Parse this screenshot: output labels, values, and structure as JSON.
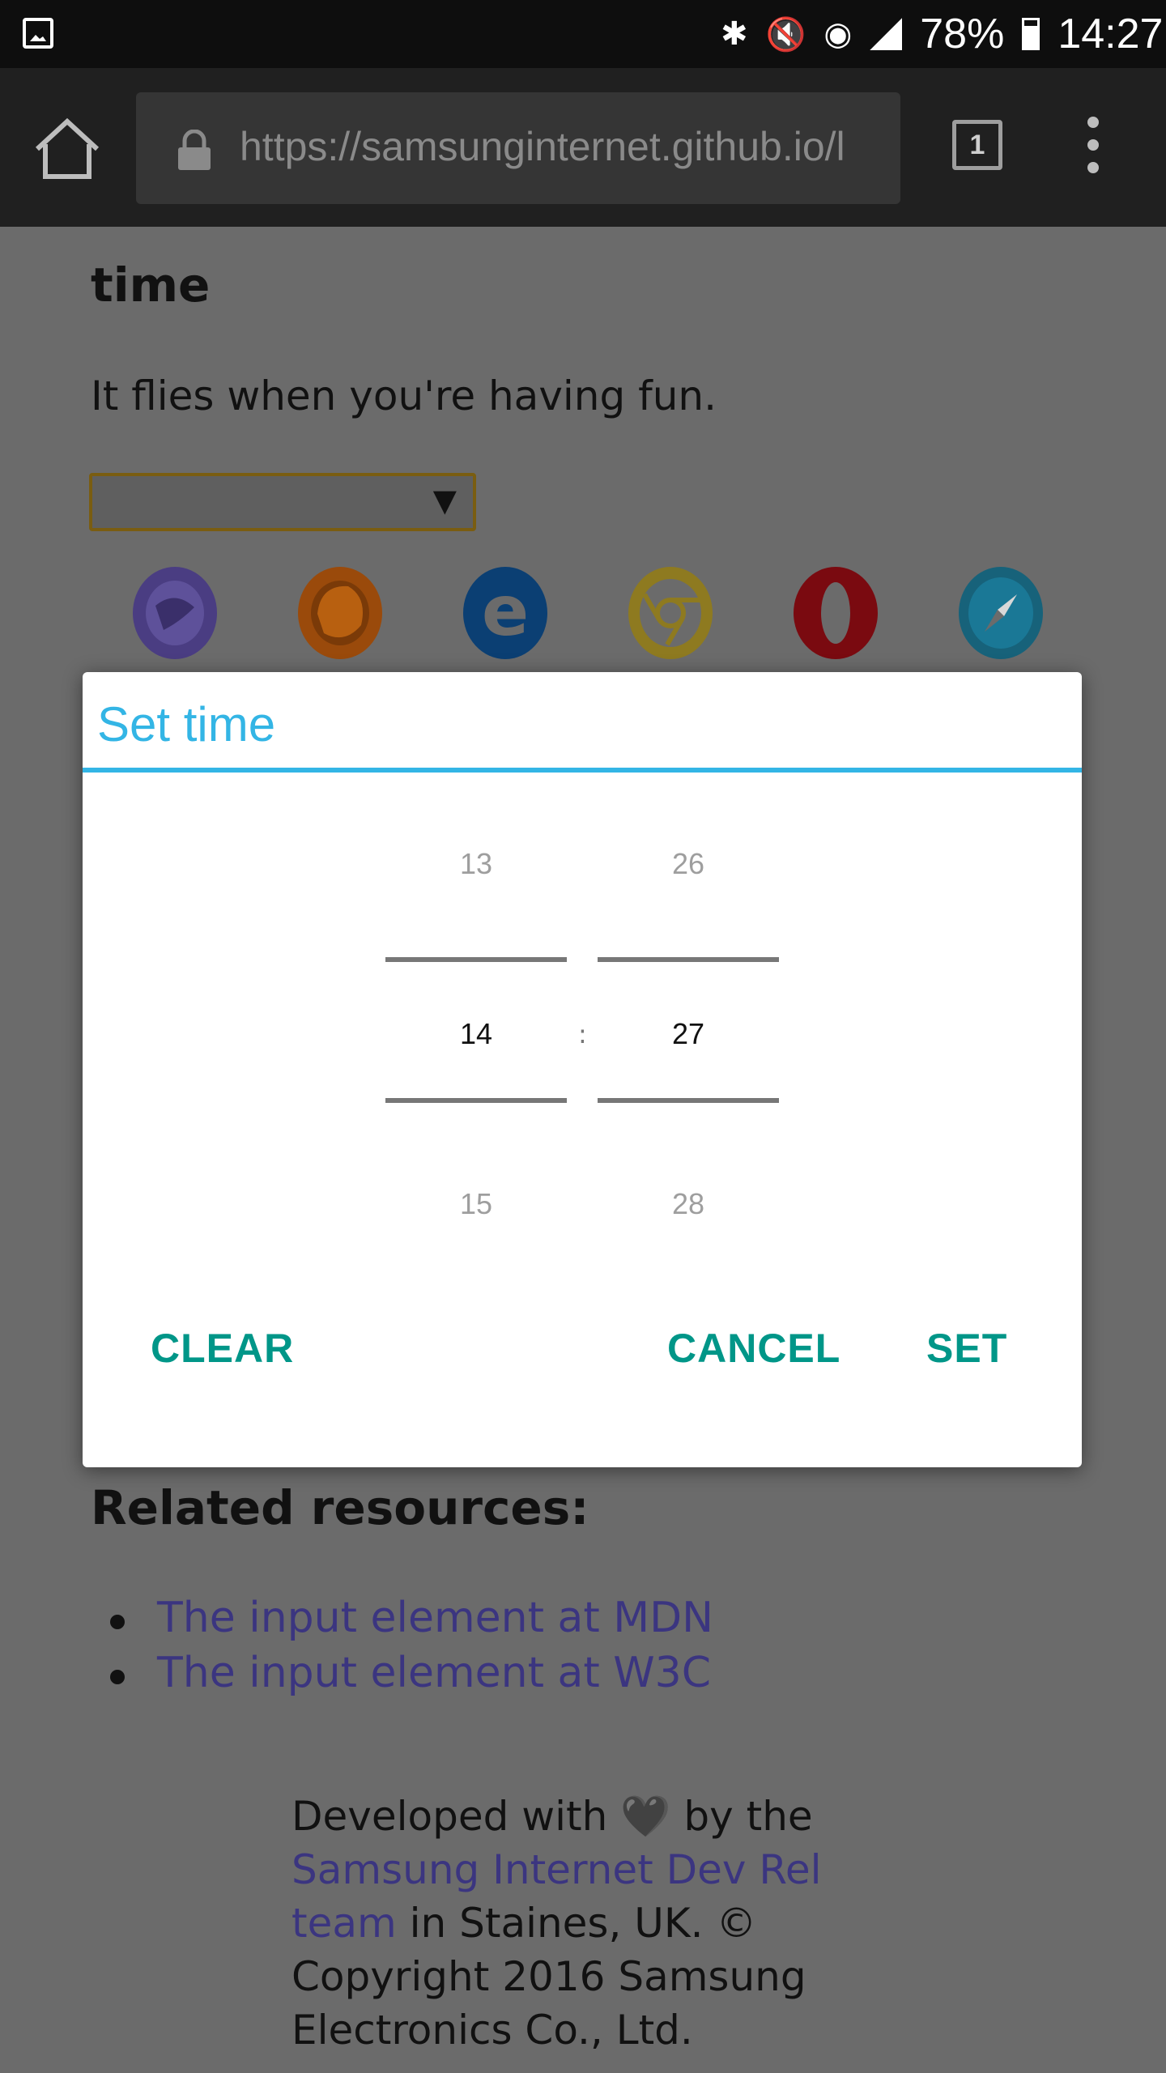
{
  "status_bar": {
    "battery": "78%",
    "time": "14:27",
    "icons": [
      "gallery-icon",
      "bluetooth-icon",
      "mute-icon",
      "wifi-icon",
      "signal-icon",
      "battery-icon"
    ]
  },
  "browser": {
    "url": "https://samsunginternet.github.io/l",
    "tab_count": "1"
  },
  "page": {
    "title": "time",
    "description": "It flies when you're having fun.",
    "select_arrow": "▼",
    "browser_icons": [
      "samsung-internet-icon",
      "firefox-icon",
      "edge-icon",
      "chrome-icon",
      "opera-icon",
      "safari-icon"
    ],
    "related_heading": "Related resources:",
    "related_links": [
      "The input element at MDN",
      "The input element at W3C"
    ],
    "footer": {
      "prefix": "Developed with",
      "heart": "🖤",
      "by_the": "by the",
      "link": "Samsung Internet Dev Rel team",
      "suffix": "in Staines, UK. © Copyright 2016 Samsung Electronics Co., Ltd."
    }
  },
  "dialog": {
    "title": "Set time",
    "hours": {
      "prev": "13",
      "current": "14",
      "next": "15"
    },
    "minutes": {
      "prev": "26",
      "current": "27",
      "next": "28"
    },
    "separator": ":",
    "buttons": {
      "clear": "CLEAR",
      "cancel": "CANCEL",
      "set": "SET"
    }
  },
  "colors": {
    "accent": "#33b5e5",
    "button": "#009688",
    "link": "#3b3580"
  }
}
